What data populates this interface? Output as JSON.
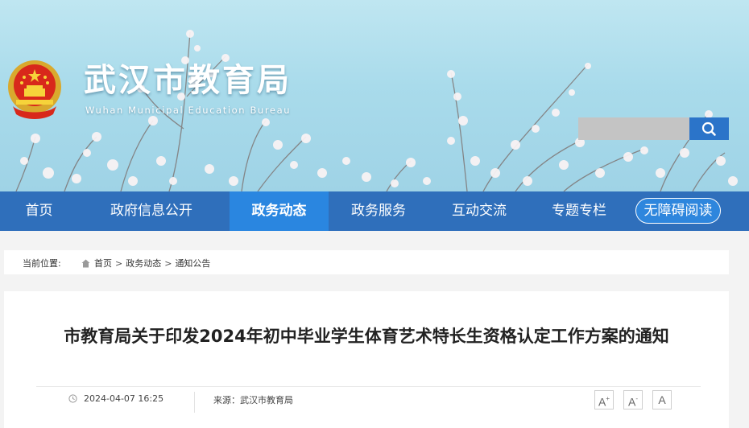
{
  "header": {
    "title": "武汉市教育局",
    "subtitle": "Wuhan Municipal Education Bureau",
    "emblem_icon": "national-emblem-icon"
  },
  "search": {
    "placeholder": "",
    "icon": "search-icon"
  },
  "nav": {
    "items": [
      {
        "label": "首页"
      },
      {
        "label": "政府信息公开"
      },
      {
        "label": "政务动态",
        "active": true
      },
      {
        "label": "政务服务"
      },
      {
        "label": "互动交流"
      },
      {
        "label": "专题专栏"
      }
    ],
    "accessibility_label": "无障碍阅读"
  },
  "breadcrumb": {
    "label": "当前位置:",
    "items": [
      "首页",
      "政务动态",
      "通知公告"
    ],
    "separator": ">"
  },
  "article": {
    "title": "市教育局关于印发2024年初中毕业学生体育艺术特长生资格认定工作方案的通知",
    "date": "2024-04-07 16:25",
    "source": "来源：武汉市教育局",
    "font_size_buttons": [
      "A+",
      "A-",
      "A"
    ]
  },
  "colors": {
    "nav_bg": "#2f6fbb",
    "nav_active": "#2a86e0",
    "search_button": "#2b74c9",
    "sky": "#a9dbeb"
  }
}
